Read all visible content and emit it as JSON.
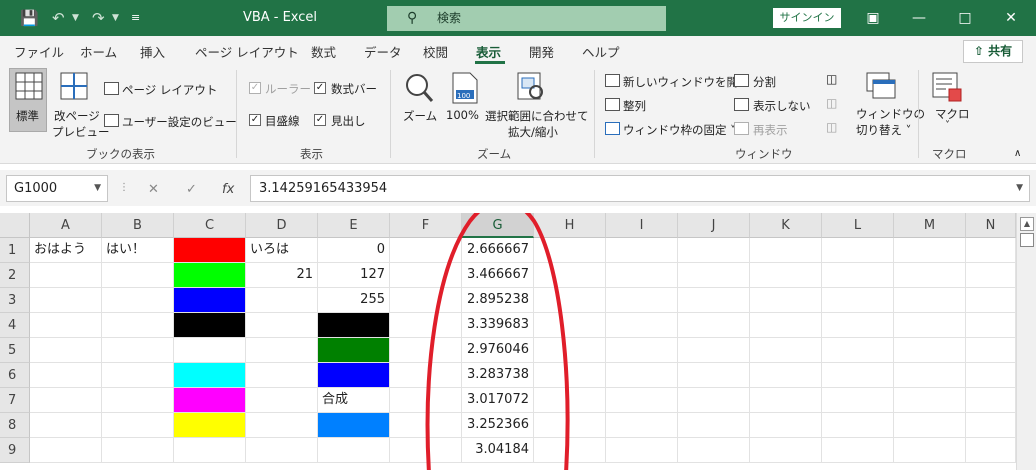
{
  "titlebar": {
    "app_title": "VBA  -  Excel",
    "search_placeholder": "検索",
    "signin_label": "サインイン"
  },
  "menu": {
    "items": [
      "ファイル",
      "ホーム",
      "挿入",
      "ページ レイアウト",
      "数式",
      "データ",
      "校閲",
      "表示",
      "開発",
      "ヘルプ"
    ],
    "active": "表示",
    "share_label": "共有"
  },
  "ribbon": {
    "book_views": {
      "normal": "標準",
      "page_break_line1": "改ページ",
      "page_break_line2": "プレビュー",
      "page_layout": "ページ レイアウト",
      "custom_views": "ユーザー設定のビュー",
      "group_label": "ブックの表示"
    },
    "show": {
      "ruler": "ルーラー",
      "formula_bar": "数式バー",
      "gridlines": "目盛線",
      "headings": "見出し",
      "group_label": "表示"
    },
    "zoom": {
      "zoom": "ズーム",
      "hundred": "100%",
      "selection_line1": "選択範囲に合わせて",
      "selection_line2": "拡大/縮小",
      "group_label": "ズーム"
    },
    "window": {
      "new_window": "新しいウィンドウを開く",
      "arrange": "整列",
      "freeze": "ウィンドウ枠の固定",
      "split": "分割",
      "hide": "表示しない",
      "unhide": "再表示",
      "switch_line1": "ウィンドウの",
      "switch_line2": "切り替え",
      "group_label": "ウィンドウ"
    },
    "macros": {
      "macro": "マクロ",
      "group_label": "マクロ"
    }
  },
  "formula_bar": {
    "name_box": "G1000",
    "formula": "3.14259165433954"
  },
  "sheet": {
    "columns": [
      "A",
      "B",
      "C",
      "D",
      "E",
      "F",
      "G",
      "H",
      "I",
      "J",
      "K",
      "L",
      "M",
      "N"
    ],
    "selected_column": "G",
    "rows": [
      "1",
      "2",
      "3",
      "4",
      "5",
      "6",
      "7",
      "8",
      "9"
    ],
    "cells": {
      "A1": "おはよう",
      "B1": "はい！",
      "D1": "いろは",
      "E1": "0",
      "G1": "2.666667",
      "D2": "21",
      "E2": "127",
      "G2": "3.466667",
      "E3": "255",
      "G3": "2.895238",
      "G4": "3.339683",
      "G5": "2.976046",
      "G6": "3.283738",
      "E7": "合成",
      "G7": "3.017072",
      "G8": "3.252366",
      "G9": "3.04184"
    },
    "cell_colors": {
      "C1": "#ff0000",
      "C2": "#00ff00",
      "C3": "#0000ff",
      "C4": "#000000",
      "C6": "#00ffff",
      "C7": "#ff00ff",
      "C8": "#ffff00",
      "E4": "#000000",
      "E5": "#008000",
      "E6": "#0000ff",
      "E8": "#0080ff"
    },
    "annotation_color": "#e01e2a"
  }
}
